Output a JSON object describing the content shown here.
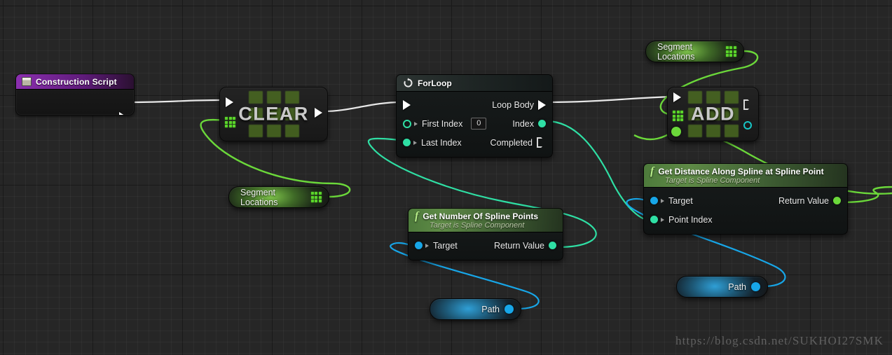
{
  "graph": {
    "watermark": "https://blog.csdn.net/SUKHOI27SMK",
    "background_color": "#262626",
    "grid_color": "#2f2f2f"
  },
  "colors": {
    "exec_wire": "#e8e8e8",
    "array_wire": "#6bd83a",
    "int_wire": "#2fdfa4",
    "object_wire": "#17a6e8",
    "event_header": "#8b2fb0",
    "function_header": "#5e8a46"
  },
  "nodes": {
    "construction_script": {
      "title": "Construction Script",
      "icon": "script-icon"
    },
    "clear": {
      "title": "CLEAR",
      "icon": "array-grid-icon"
    },
    "for_loop": {
      "title": "ForLoop",
      "icon": "loop-icon",
      "inputs": [
        {
          "label": "First Index",
          "value": "0",
          "pin": "int-ring"
        },
        {
          "label": "Last Index",
          "pin": "int-dot"
        }
      ],
      "outputs": [
        {
          "label": "Loop Body",
          "pin": "exec"
        },
        {
          "label": "Index",
          "pin": "int-dot"
        },
        {
          "label": "Completed",
          "pin": "exec-hollow"
        }
      ]
    },
    "add": {
      "title": "ADD",
      "icon": "array-grid-icon"
    },
    "get_number_of_spline_points": {
      "title": "Get Number Of Spline Points",
      "subtitle": "Target is Spline Component",
      "icon": "function-icon",
      "inputs": [
        {
          "label": "Target",
          "pin": "object-dot"
        }
      ],
      "outputs": [
        {
          "label": "Return Value",
          "pin": "int-dot"
        }
      ]
    },
    "get_distance_along_spline": {
      "title": "Get Distance Along Spline at Spline Point",
      "subtitle": "Target is Spline Component",
      "icon": "function-icon",
      "inputs": [
        {
          "label": "Target",
          "pin": "object-dot"
        },
        {
          "label": "Point Index",
          "pin": "int-dot"
        }
      ],
      "outputs": [
        {
          "label": "Return Value",
          "pin": "float-dot"
        }
      ]
    },
    "segment_locations_top": {
      "label": "Segment Locations",
      "pin": "array-grid-icon"
    },
    "segment_locations_mid": {
      "label": "Segment Locations",
      "pin": "array-grid-icon"
    },
    "path_lower": {
      "label": "Path",
      "pin": "object-dot"
    },
    "path_right": {
      "label": "Path",
      "pin": "object-dot"
    }
  }
}
